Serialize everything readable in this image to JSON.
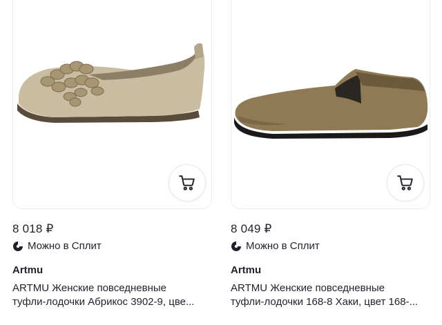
{
  "products": [
    {
      "price": "8 018 ₽",
      "split_label": "Можно в Сплит",
      "brand": "Artmu",
      "title_line1": "ARTMU Женские повседневные",
      "title_line2": "туфли-лодочки Абрикос 3902-9, цве...",
      "cart_icon": "shopping-cart-icon"
    },
    {
      "price": "8 049 ₽",
      "split_label": "Можно в Сплит",
      "brand": "Artmu",
      "title_line1": "ARTMU Женские повседневные",
      "title_line2": "туфли-лодочки 168-8 Хаки, цвет 168-...",
      "cart_icon": "shopping-cart-icon"
    }
  ],
  "colors": {
    "text": "#1f2229",
    "card_border": "#eaecef",
    "shoe1": "#c9bca0",
    "shoe2": "#8f7a55"
  }
}
